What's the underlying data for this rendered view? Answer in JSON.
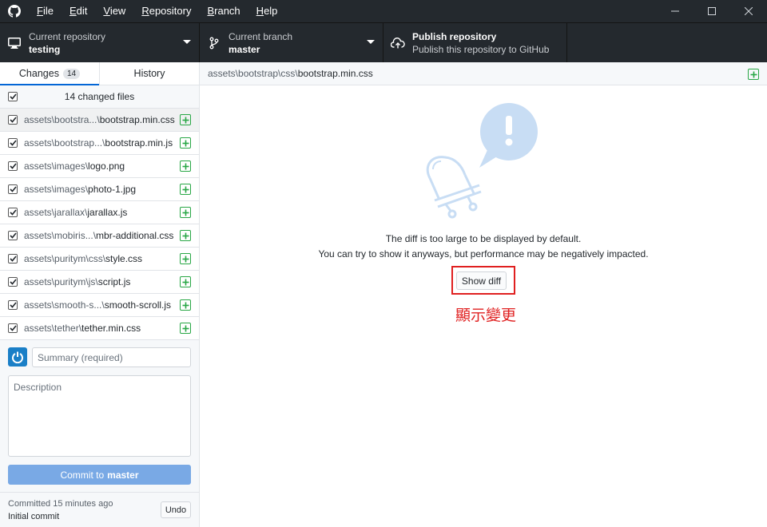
{
  "app": {
    "menu": [
      {
        "label": "File",
        "mnemonic": "F",
        "rest": "ile"
      },
      {
        "label": "Edit",
        "mnemonic": "E",
        "rest": "dit"
      },
      {
        "label": "View",
        "mnemonic": "V",
        "rest": "iew"
      },
      {
        "label": "Repository",
        "mnemonic": "R",
        "rest": "epository"
      },
      {
        "label": "Branch",
        "mnemonic": "B",
        "rest": "ranch"
      },
      {
        "label": "Help",
        "mnemonic": "H",
        "rest": "elp"
      }
    ]
  },
  "toolbar": {
    "repo_label": "Current repository",
    "repo_value": "testing",
    "branch_label": "Current branch",
    "branch_value": "master",
    "publish_title": "Publish repository",
    "publish_desc": "Publish this repository to GitHub"
  },
  "sidebar": {
    "tab_changes": "Changes",
    "tab_changes_count": "14",
    "tab_history": "History",
    "changed_files_label": "14 changed files",
    "files": [
      {
        "dir": "assets\\bootstra...\\",
        "name": "bootstrap.min.css",
        "selected": true
      },
      {
        "dir": "assets\\bootstrap...\\",
        "name": "bootstrap.min.js",
        "selected": false
      },
      {
        "dir": "assets\\images\\",
        "name": "logo.png",
        "selected": false
      },
      {
        "dir": "assets\\images\\",
        "name": "photo-1.jpg",
        "selected": false
      },
      {
        "dir": "assets\\jarallax\\",
        "name": "jarallax.js",
        "selected": false
      },
      {
        "dir": "assets\\mobiris...\\",
        "name": "mbr-additional.css",
        "selected": false
      },
      {
        "dir": "assets\\puritym\\css\\",
        "name": "style.css",
        "selected": false
      },
      {
        "dir": "assets\\puritym\\js\\",
        "name": "script.js",
        "selected": false
      },
      {
        "dir": "assets\\smooth-s...\\",
        "name": "smooth-scroll.js",
        "selected": false
      },
      {
        "dir": "assets\\tether\\",
        "name": "tether.min.css",
        "selected": false
      }
    ],
    "summary_placeholder": "Summary (required)",
    "description_placeholder": "Description",
    "commit_prefix": "Commit to",
    "commit_branch": "master",
    "last_commit_time": "Committed 15 minutes ago",
    "last_commit_msg": "Initial commit",
    "undo_label": "Undo"
  },
  "main": {
    "path_dir": "assets\\bootstrap\\css\\",
    "path_file": "bootstrap.min.css",
    "diff_msg_line1": "The diff is too large to be displayed by default.",
    "diff_msg_line2": "You can try to show it anyways, but performance may be negatively impacted.",
    "show_diff_label": "Show diff",
    "annotation_text": "顯示變更",
    "annotation_color": "#e02020"
  },
  "colors": {
    "titlebar_bg": "#24292e",
    "accent_blue": "#0366d6",
    "commit_button": "#79a9e5",
    "added_green": "#28a745",
    "illustration_blue": "#c8ddf4"
  }
}
